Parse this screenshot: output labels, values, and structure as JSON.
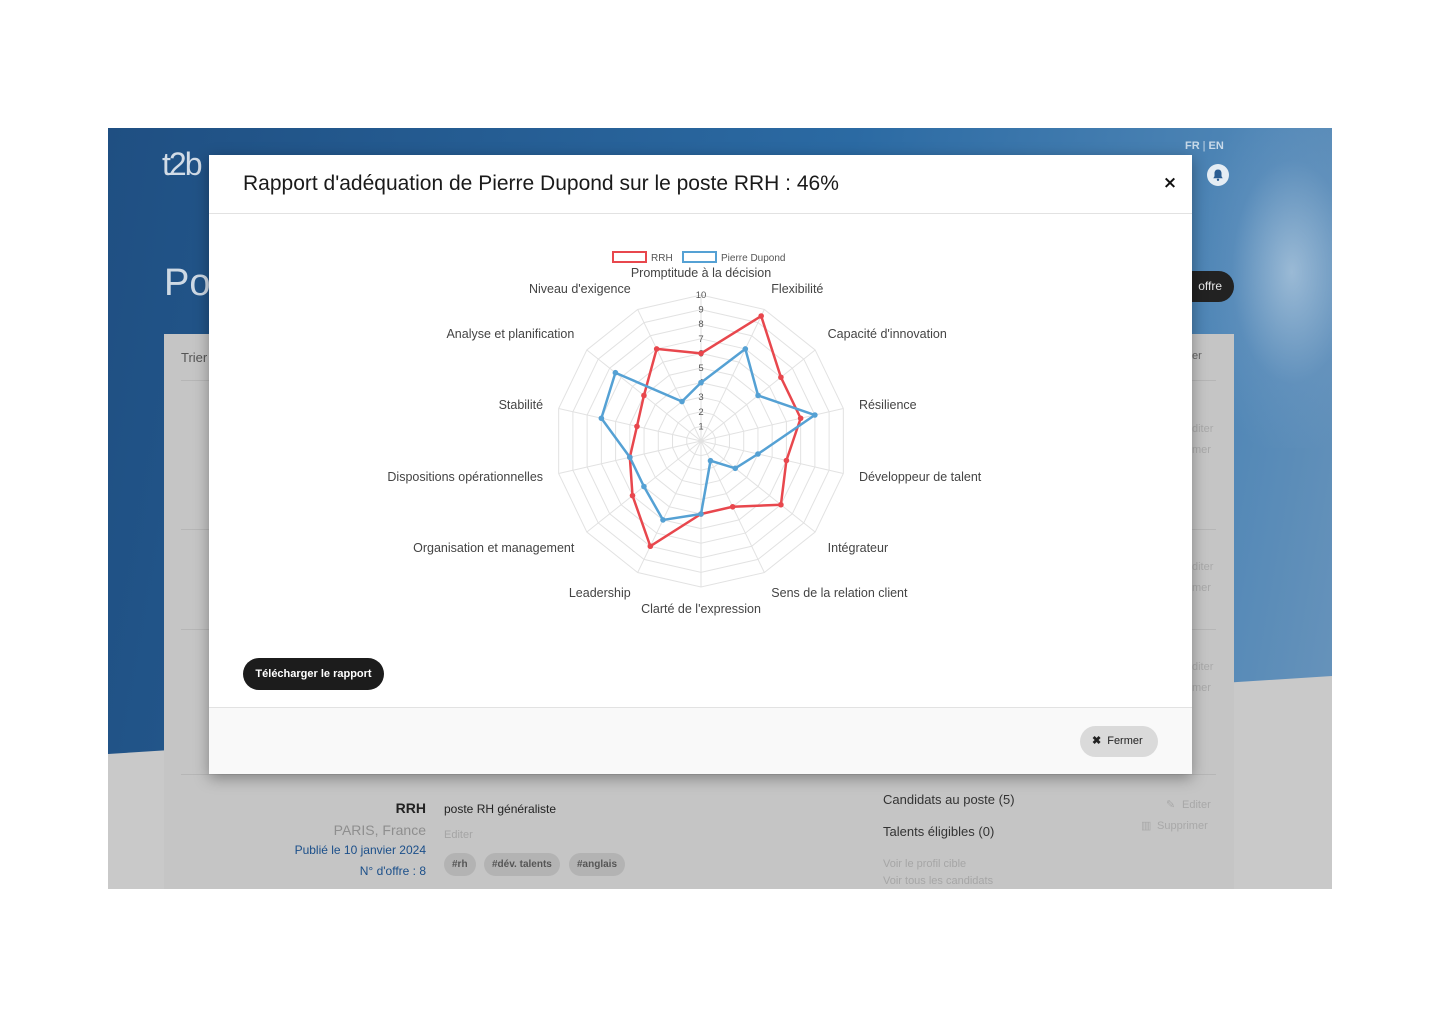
{
  "app": {
    "logo": "t2b",
    "lang": {
      "fr": "FR",
      "separator": "|",
      "en": "EN"
    },
    "page_title": "Po",
    "new_offer_label": "offre",
    "sort_label": "Trier",
    "header_right": "er",
    "ghost_edit": "diter",
    "ghost_delete": "mer"
  },
  "offer": {
    "title": "RRH",
    "location": "PARIS, France",
    "published": "Publié le 10 janvier 2024",
    "number": "N° d'offre : 8",
    "description": "poste RH généraliste",
    "edit_desc": "Editer",
    "tags": [
      "#rh",
      "#dév. talents",
      "#anglais"
    ],
    "candidates": "Candidats au poste (5)",
    "talents": "Talents éligibles (0)",
    "view_profile": "Voir le profil cible",
    "view_candidates": "Voir tous les candidats",
    "edit": "Editer",
    "delete": "Supprimer"
  },
  "modal": {
    "title": "Rapport d'adéquation de Pierre Dupond sur le poste RRH : 46%",
    "close_symbol": "×",
    "download_label": "Télécharger le rapport",
    "footer_close_symbol": "✖",
    "footer_close_label": "Fermer"
  },
  "chart_data": {
    "type": "radar",
    "categories": [
      "Promptitude à la décision",
      "Flexibilité",
      "Capacité d'innovation",
      "Résilience",
      "Développeur de talent",
      "Intégrateur",
      "Sens de la relation client",
      "Clarté de l'expression",
      "Leadership",
      "Organisation et management",
      "Dispositions opérationnelles",
      "Stabilité",
      "Analyse et planification",
      "Niveau d'exigence"
    ],
    "ticks": [
      "1",
      "2",
      "3",
      "4",
      "5",
      "6",
      "7",
      "8",
      "9",
      "10"
    ],
    "rmax": 10,
    "legend_position": "top",
    "series": [
      {
        "name": "RRH",
        "color": "#e8474d",
        "values": [
          6,
          9.5,
          7,
          7,
          6,
          7,
          5,
          5,
          8,
          6,
          5,
          4.5,
          5,
          7
        ]
      },
      {
        "name": "Pierre Dupond",
        "color": "#55a1d4",
        "values": [
          4,
          7,
          5,
          8,
          4,
          3,
          1.5,
          5,
          6,
          5,
          5,
          7,
          7.5,
          3
        ]
      }
    ]
  }
}
